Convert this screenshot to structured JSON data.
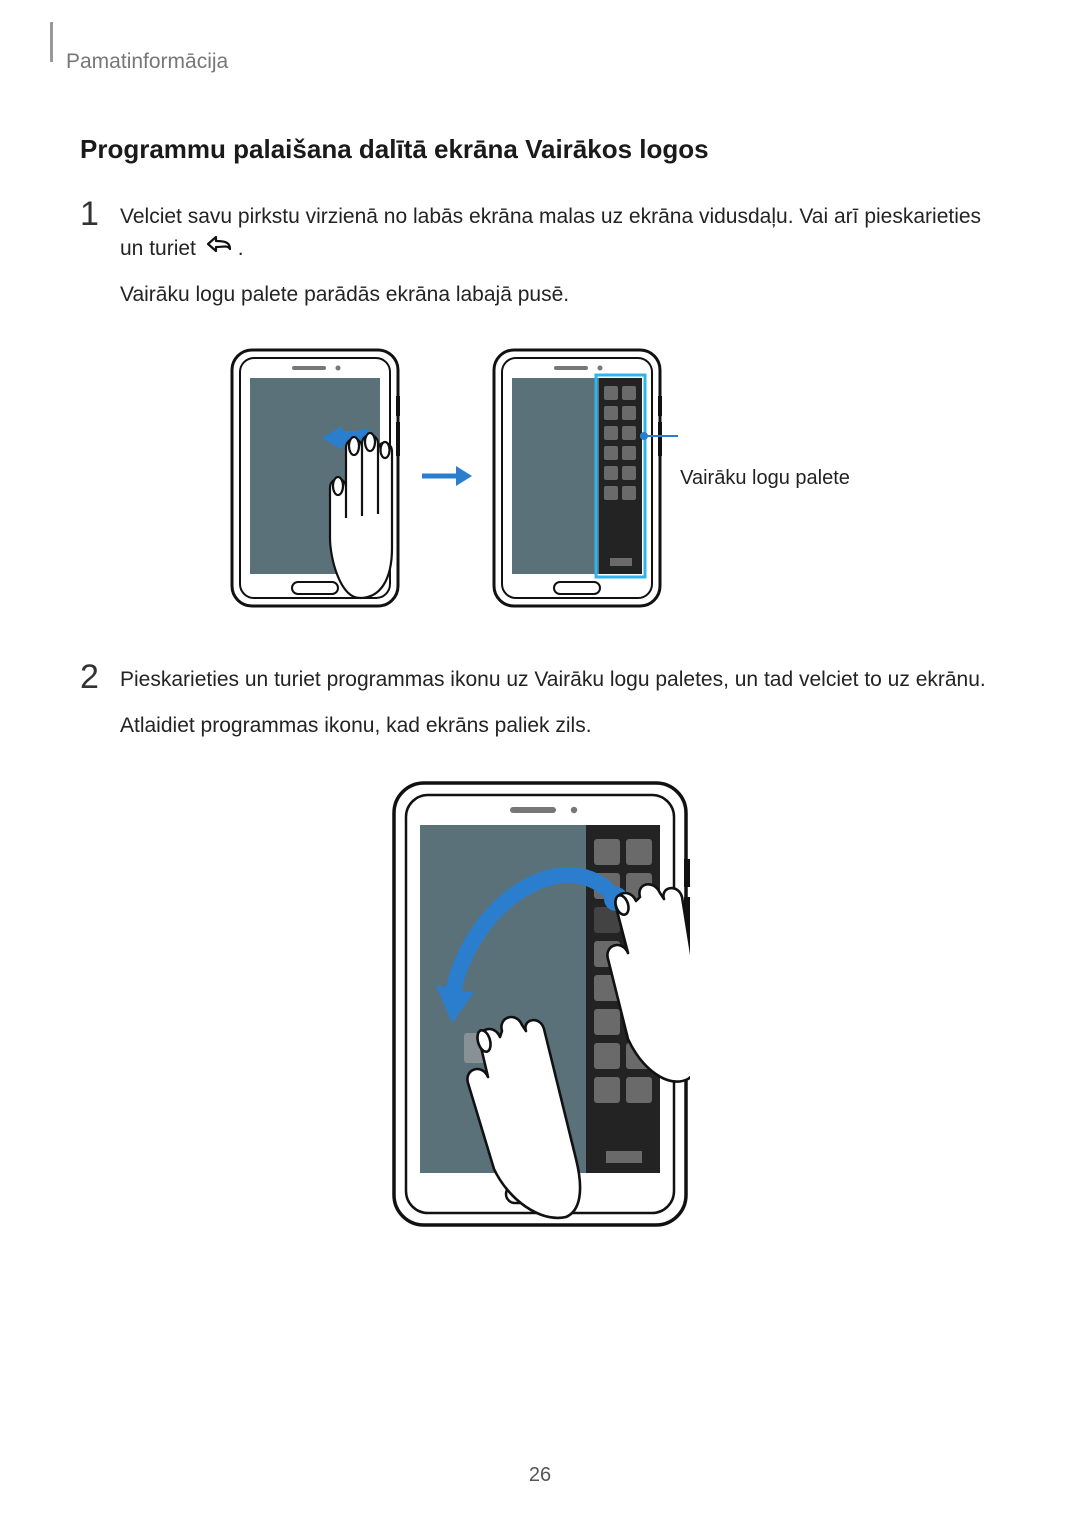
{
  "breadcrumb": "Pamatinformācija",
  "section_title": "Programmu palaišana dalītā ekrāna Vairākos logos",
  "step1": {
    "num": "1",
    "line1a": "Velciet savu pirkstu virzienā no labās ekrāna malas uz ekrāna vidusdaļu. Vai arī pieskarieties un turiet ",
    "line1b": ".",
    "line2": "Vairāku logu palete parādās ekrāna labajā pusē."
  },
  "callout1": "Vairāku logu palete",
  "step2": {
    "num": "2",
    "line1": "Pieskarieties un turiet programmas ikonu uz Vairāku logu paletes, un tad velciet to uz ekrānu.",
    "line2": "Atlaidiet programmas ikonu, kad ekrāns paliek zils."
  },
  "page_number": "26"
}
